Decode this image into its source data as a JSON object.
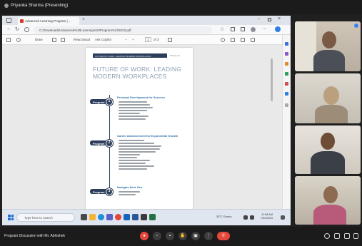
{
  "meeting": {
    "presenter_label": "Priyanka Sharma (Presenting)",
    "title": "Program Discussion with Mr. Abhishek"
  },
  "browser": {
    "tab_title": "Advanced Learning Program | ...",
    "url": "C:/Downloads/Advanced%20Learning%20Program%202023.pdf",
    "toolbar": {
      "draw": "Draw",
      "read_aloud": "Read aloud",
      "not_copilot": "Ask Copilot",
      "page_current": "1",
      "page_total": "of 3"
    }
  },
  "pdf": {
    "header_band": "FUTURE OF WORK: LEADING MODERN WORKPLACES",
    "header_right": "PAGE | 01",
    "title": "FUTURE OF WORK: LEADING MODERN WORKPLACES",
    "programs": [
      {
        "pill": "Program",
        "number": "1",
        "heading": "Personal Development for Success"
      },
      {
        "pill": "Program",
        "number": "2",
        "heading": "Career Advancement for Exponential Growth"
      },
      {
        "pill": "Program",
        "number": "3",
        "heading": "Navigate Next Gen"
      }
    ]
  },
  "taskbar": {
    "search_placeholder": "Type here to search",
    "weather": "33°C Sunny",
    "time": "11:08 AM",
    "date": "7/22/2024"
  },
  "participants": [
    {
      "name": ""
    },
    {
      "name": ""
    },
    {
      "name": ""
    },
    {
      "name": ""
    }
  ],
  "colors": {
    "accent_navy": "#2c3e5b",
    "link_blue": "#2e6fb0",
    "end_call_red": "#e5473b"
  }
}
